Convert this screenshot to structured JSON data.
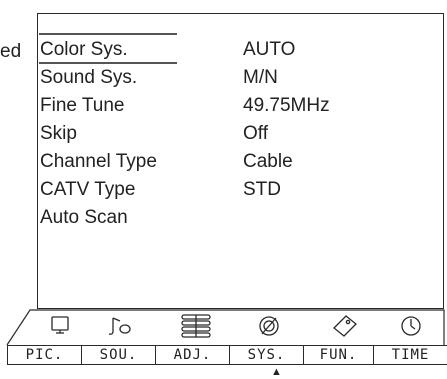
{
  "edge_text": "ed",
  "menu": {
    "rows": [
      {
        "label": "Color Sys.",
        "value": "AUTO"
      },
      {
        "label": "Sound Sys.",
        "value": "M/N"
      },
      {
        "label": "Fine Tune",
        "value": "49.75MHz"
      },
      {
        "label": "Skip",
        "value": "Off"
      },
      {
        "label": "Channel Type",
        "value": "Cable"
      },
      {
        "label": "CATV Type",
        "value": "STD"
      },
      {
        "label": "Auto Scan",
        "value": ""
      }
    ],
    "selected_item": "Color Sys."
  },
  "tabs": [
    {
      "label": "PIC.",
      "icon": "monitor-icon"
    },
    {
      "label": "SOU.",
      "icon": "music-note-icon"
    },
    {
      "label": "ADJ.",
      "icon": "adjust-sliders-icon"
    },
    {
      "label": "SYS.",
      "icon": "satellite-dish-icon"
    },
    {
      "label": "FUN.",
      "icon": "function-tag-icon"
    },
    {
      "label": "TIME",
      "icon": "clock-icon"
    }
  ],
  "active_tab": "SYS.",
  "pointer_glyph": "▲",
  "colors": {
    "background": "#ffffff",
    "text": "#222222",
    "lines": "#2a2a2a"
  }
}
